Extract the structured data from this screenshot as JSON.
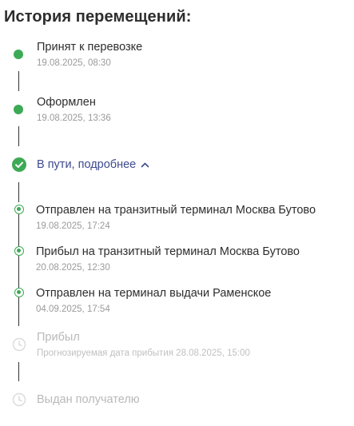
{
  "title": "История перемещений:",
  "steps": [
    {
      "label": "Принят к перевозке",
      "time": "19.08.2025, 08:30"
    },
    {
      "label": "Оформлен",
      "time": "19.08.2025, 13:36"
    }
  ],
  "in_transit": {
    "label": "В пути, подробнее"
  },
  "sub_steps": [
    {
      "label": "Отправлен на транзитный терминал Москва Бутово",
      "time": "19.08.2025, 17:24"
    },
    {
      "label": "Прибыл на транзитный терминал Москва Бутово",
      "time": "20.08.2025, 12:30"
    },
    {
      "label": "Отправлен на терминал выдачи Раменское",
      "time": "04.09.2025, 17:54"
    }
  ],
  "pending": [
    {
      "label": "Прибыл",
      "time": "Прогнозируемая дата прибытия 28.08.2025, 15:00"
    },
    {
      "label": "Выдан получателю"
    }
  ],
  "colors": {
    "green": "#3daa55",
    "link": "#3e4a8f",
    "muted": "#c0c0c0"
  },
  "icons": {
    "done": "filled-dot-icon",
    "current": "check-circle-icon",
    "sub": "ring-dot-icon",
    "pending": "clock-icon",
    "toggle": "chevron-up-icon"
  }
}
